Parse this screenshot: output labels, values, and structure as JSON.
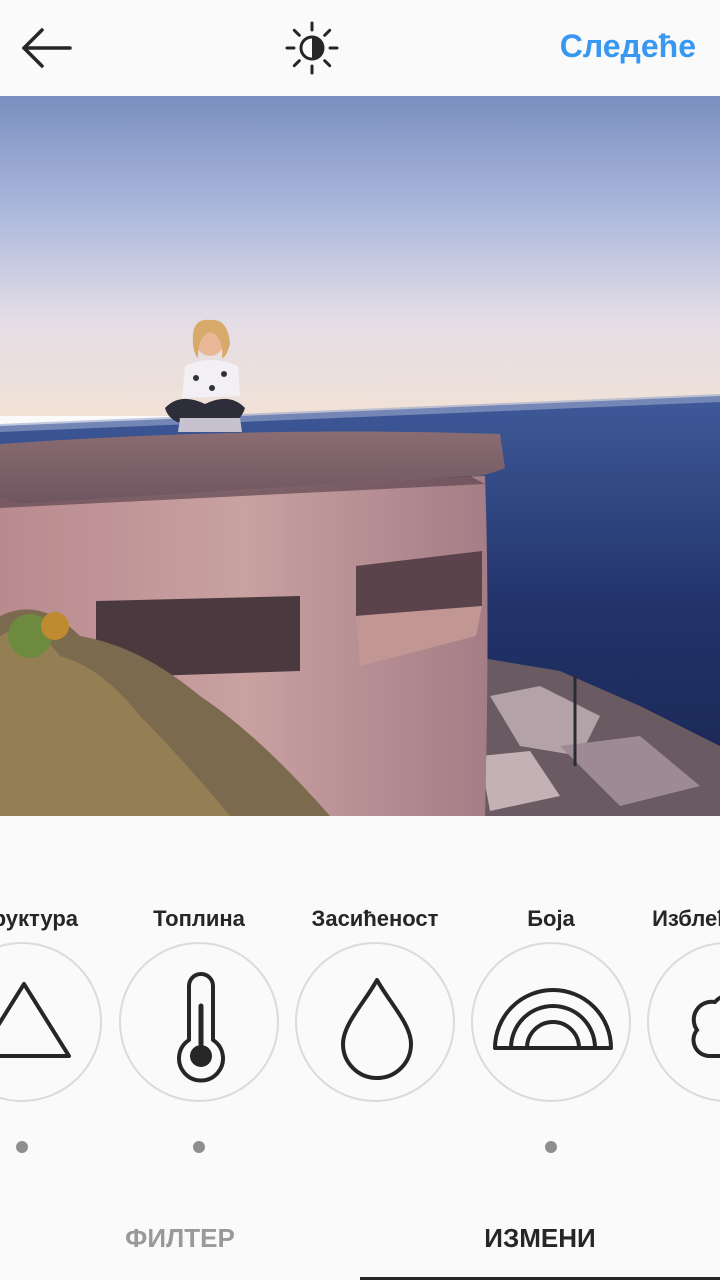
{
  "header": {
    "back_icon": "arrow-left-icon",
    "lux_icon": "sun-contrast-icon",
    "next_label": "Следеће",
    "accent_color": "#3897f0"
  },
  "photo": {
    "subject": "girl sitting on concrete bunker by the sea"
  },
  "tools": [
    {
      "label": "Структура",
      "icon": "triangle-icon",
      "active_dot": true
    },
    {
      "label": "Топлина",
      "icon": "thermometer-icon",
      "active_dot": true
    },
    {
      "label": "Засићеност",
      "icon": "drop-icon",
      "active_dot": false
    },
    {
      "label": "Боја",
      "icon": "rainbow-icon",
      "active_dot": true
    },
    {
      "label": "Изблеђивање",
      "icon": "fade-cloud-icon",
      "active_dot": false
    }
  ],
  "tabs": {
    "filter_label": "ФИЛТЕР",
    "edit_label": "ИЗМЕНИ",
    "active": "edit"
  }
}
